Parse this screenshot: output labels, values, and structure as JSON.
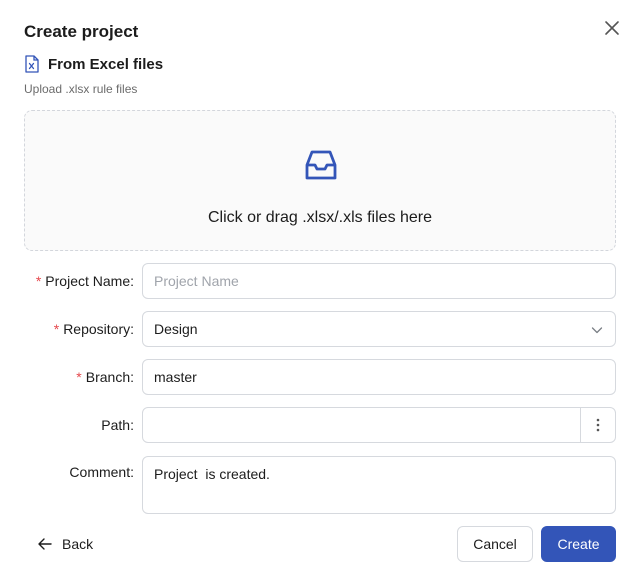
{
  "dialog": {
    "title": "Create project",
    "source_title": "From Excel files",
    "source_subtitle": "Upload .xlsx rule files",
    "dropzone_text": "Click or drag .xlsx/.xls files here"
  },
  "form": {
    "project_name": {
      "label": "Project Name:",
      "required": true,
      "value": "",
      "placeholder": "Project Name"
    },
    "repository": {
      "label": "Repository:",
      "required": true,
      "value": "Design"
    },
    "branch": {
      "label": "Branch:",
      "required": true,
      "value": "master"
    },
    "path": {
      "label": "Path:",
      "required": false,
      "value": ""
    },
    "comment": {
      "label": "Comment:",
      "required": false,
      "value": "Project  is created."
    },
    "required_marker": "*"
  },
  "footer": {
    "back_label": "Back",
    "cancel_label": "Cancel",
    "create_label": "Create"
  },
  "colors": {
    "primary": "#3355b8",
    "required": "#e5484d"
  },
  "icons": [
    "close-icon",
    "excel-file-icon",
    "inbox-icon",
    "chevron-down-icon",
    "more-vertical-icon",
    "arrow-left-icon"
  ]
}
